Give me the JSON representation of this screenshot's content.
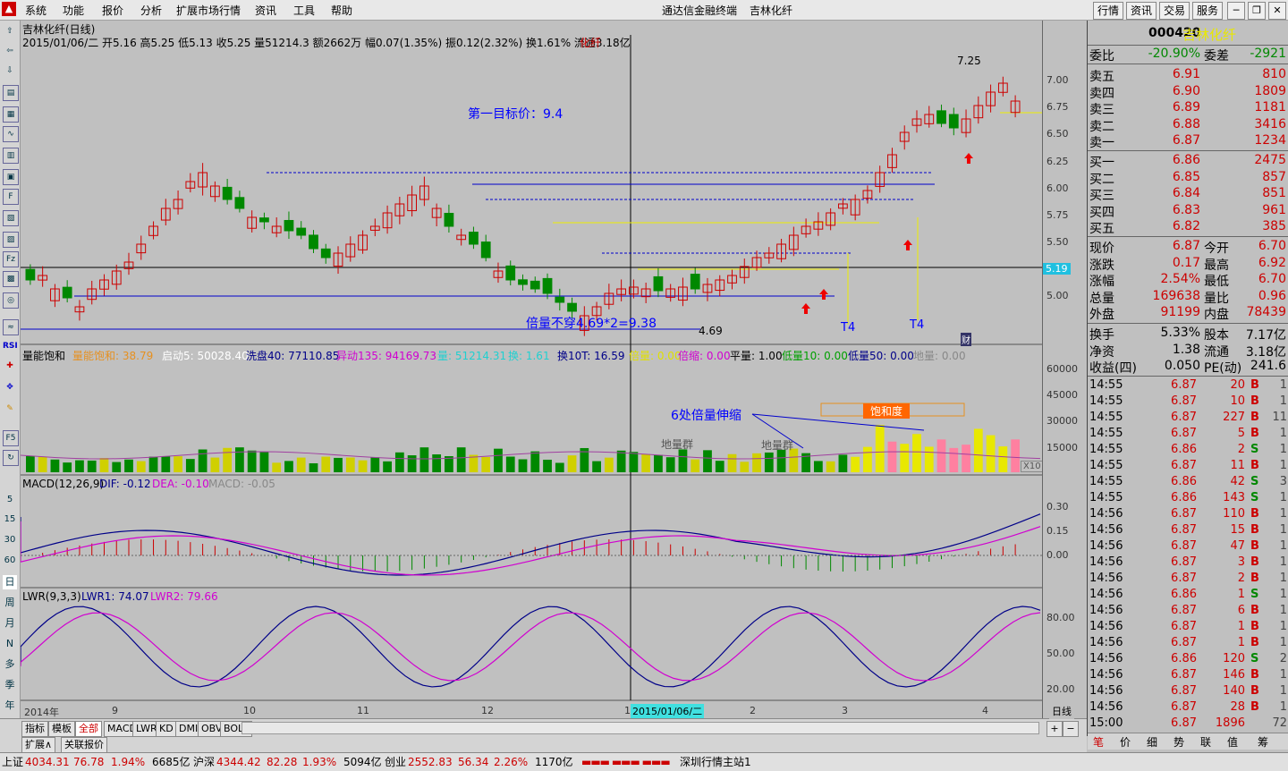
{
  "menu": {
    "items": [
      "系统",
      "功能",
      "报价",
      "分析",
      "扩展市场行情",
      "资讯",
      "工具",
      "帮助"
    ],
    "center_title": "通达信金融终端",
    "stock_title": "吉林化纤",
    "right_buttons": [
      "行情",
      "资讯",
      "交易",
      "服务"
    ]
  },
  "left_toolbar": {
    "period_labels": [
      "15",
      "30",
      "60",
      "日",
      "周",
      "月",
      "N",
      "多",
      "季",
      "年"
    ]
  },
  "chart_header": {
    "title": "吉林化纤(日线)",
    "info": "2015/01/06/二 开5.16 高5.25 低5.13 收5.25 量51214.3 额2662万 幅0.07(1.35%) 振0.12(2.32%) 换1.61% 流通3.18亿",
    "tag": "化纤"
  },
  "annotations": {
    "target": "第一目标价：9.4",
    "double_vol": "倍量不穿4.69*2=9.38",
    "low_label": "4.69",
    "high_label": "7.25",
    "t4_a": "T4",
    "t4_b": "T4",
    "vol_note": "6处倍量伸缩",
    "ground_a": "地量群",
    "ground_b": "地量群",
    "saturation": "饱和度",
    "fin_marker": "财",
    "price_tag": "5.19"
  },
  "vol_header": {
    "name": "量能饱和",
    "a": "量能饱和: 38.79",
    "b": "启动5: 50028.40",
    "c": "洗盘40: 77110.85",
    "d": "异动135: 94169.73",
    "e": "量: 51214.31",
    "f": "换: 1.61",
    "g": "换10T: 16.59",
    "h": "倍量: 0.00",
    "i": "倍缩: 0.00",
    "j": "平量: 1.00",
    "k": "低量10: 0.00",
    "l": "低量50: 0.00",
    "m": "地量: 0.00",
    "x10": "X10"
  },
  "macd_header": {
    "name": "MACD(12,26,9)",
    "dif": "DIF: -0.12",
    "dea": "DEA: -0.10",
    "macd": "MACD: -0.05"
  },
  "lwr_header": {
    "name": "LWR(9,3,3)",
    "lwr1": "LWR1: 74.07",
    "lwr2": "LWR2: 79.66"
  },
  "axis": {
    "price": [
      "7.00",
      "6.75",
      "6.50",
      "6.25",
      "6.00",
      "5.75",
      "5.50",
      "5.25",
      "5.00"
    ],
    "vol": [
      "60000",
      "45000",
      "30000",
      "15000"
    ],
    "macd": [
      "0.30",
      "0.15",
      "0.00"
    ],
    "lwr": [
      "80.00",
      "50.00",
      "20.00"
    ]
  },
  "x_labels": [
    "2014年",
    "9",
    "10",
    "11",
    "12",
    "1",
    "2015/01/06/二",
    "2",
    "3",
    "4"
  ],
  "quote": {
    "code": "000420",
    "name": "吉林化纤",
    "weibi_label": "委比",
    "weibi": "-20.90%",
    "weicha_label": "委差",
    "weicha": "-2921",
    "asks": [
      {
        "label": "卖五",
        "price": "6.91",
        "vol": "810"
      },
      {
        "label": "卖四",
        "price": "6.90",
        "vol": "1809"
      },
      {
        "label": "卖三",
        "price": "6.89",
        "vol": "1181"
      },
      {
        "label": "卖二",
        "price": "6.88",
        "vol": "3416"
      },
      {
        "label": "卖一",
        "price": "6.87",
        "vol": "1234"
      }
    ],
    "bids": [
      {
        "label": "买一",
        "price": "6.86",
        "vol": "2475"
      },
      {
        "label": "买二",
        "price": "6.85",
        "vol": "857"
      },
      {
        "label": "买三",
        "price": "6.84",
        "vol": "851"
      },
      {
        "label": "买四",
        "price": "6.83",
        "vol": "961"
      },
      {
        "label": "买五",
        "price": "6.82",
        "vol": "385"
      }
    ],
    "stats": [
      {
        "l1": "现价",
        "v1": "6.87",
        "l2": "今开",
        "v2": "6.70"
      },
      {
        "l1": "涨跌",
        "v1": "0.17",
        "l2": "最高",
        "v2": "6.92"
      },
      {
        "l1": "涨幅",
        "v1": "2.54%",
        "l2": "最低",
        "v2": "6.70"
      },
      {
        "l1": "总量",
        "v1": "169638",
        "l2": "量比",
        "v2": "0.96"
      },
      {
        "l1": "外盘",
        "v1": "91199",
        "l2": "内盘",
        "v2": "78439"
      }
    ],
    "fund": [
      {
        "l1": "换手",
        "v1": "5.33%",
        "l2": "股本",
        "v2": "7.17亿"
      },
      {
        "l1": "净资",
        "v1": "1.38",
        "l2": "流通",
        "v2": "3.18亿"
      },
      {
        "l1": "收益(四)",
        "v1": "0.050",
        "l2": "PE(动)",
        "v2": "241.6"
      }
    ],
    "ticks": [
      {
        "t": "14:55",
        "p": "6.87",
        "v": "20",
        "bs": "B",
        "n": "1"
      },
      {
        "t": "14:55",
        "p": "6.87",
        "v": "10",
        "bs": "B",
        "n": "1"
      },
      {
        "t": "14:55",
        "p": "6.87",
        "v": "227",
        "bs": "B",
        "n": "11"
      },
      {
        "t": "14:55",
        "p": "6.87",
        "v": "5",
        "bs": "B",
        "n": "1"
      },
      {
        "t": "14:55",
        "p": "6.86",
        "v": "2",
        "bs": "S",
        "n": "1"
      },
      {
        "t": "14:55",
        "p": "6.87",
        "v": "11",
        "bs": "B",
        "n": "1"
      },
      {
        "t": "14:55",
        "p": "6.86",
        "v": "42",
        "bs": "S",
        "n": "3"
      },
      {
        "t": "14:55",
        "p": "6.86",
        "v": "143",
        "bs": "S",
        "n": "1"
      },
      {
        "t": "14:56",
        "p": "6.87",
        "v": "110",
        "bs": "B",
        "n": "1"
      },
      {
        "t": "14:56",
        "p": "6.87",
        "v": "15",
        "bs": "B",
        "n": "1"
      },
      {
        "t": "14:56",
        "p": "6.87",
        "v": "47",
        "bs": "B",
        "n": "1"
      },
      {
        "t": "14:56",
        "p": "6.87",
        "v": "3",
        "bs": "B",
        "n": "1"
      },
      {
        "t": "14:56",
        "p": "6.87",
        "v": "2",
        "bs": "B",
        "n": "1"
      },
      {
        "t": "14:56",
        "p": "6.86",
        "v": "1",
        "bs": "S",
        "n": "1"
      },
      {
        "t": "14:56",
        "p": "6.87",
        "v": "6",
        "bs": "B",
        "n": "1"
      },
      {
        "t": "14:56",
        "p": "6.87",
        "v": "1",
        "bs": "B",
        "n": "1"
      },
      {
        "t": "14:56",
        "p": "6.87",
        "v": "1",
        "bs": "B",
        "n": "1"
      },
      {
        "t": "14:56",
        "p": "6.86",
        "v": "120",
        "bs": "S",
        "n": "2"
      },
      {
        "t": "14:56",
        "p": "6.87",
        "v": "146",
        "bs": "B",
        "n": "1"
      },
      {
        "t": "14:56",
        "p": "6.87",
        "v": "140",
        "bs": "B",
        "n": "1"
      },
      {
        "t": "14:56",
        "p": "6.87",
        "v": "28",
        "bs": "B",
        "n": "1"
      },
      {
        "t": "15:00",
        "p": "6.87",
        "v": "1896",
        "bs": "",
        "n": "72"
      }
    ],
    "bottom_tabs": [
      "笔",
      "价",
      "细",
      "势",
      "联",
      "值",
      "筹"
    ]
  },
  "bottom_tabs": {
    "row1": [
      "指标",
      "模板",
      "全部",
      "MACD",
      "LWR",
      "KD",
      "DMI",
      "OBV",
      "BOLL"
    ],
    "row2": [
      "扩展∧",
      "关联报价"
    ],
    "period_btn": "日线"
  },
  "status": {
    "sh_label": "上证",
    "sh_val": "4034.31",
    "sh_chg": "76.78",
    "sh_pct": "1.94%",
    "sh_amt": "6685亿",
    "hs_label": "沪深",
    "hs_val": "4344.42",
    "hs_chg": "82.28",
    "hs_pct": "1.93%",
    "hs_amt": "5094亿",
    "cy_label": "创业",
    "cy_val": "2552.83",
    "cy_chg": "56.34",
    "cy_pct": "2.26%",
    "cy_amt": "1170亿",
    "station": "深圳行情主站1"
  }
}
